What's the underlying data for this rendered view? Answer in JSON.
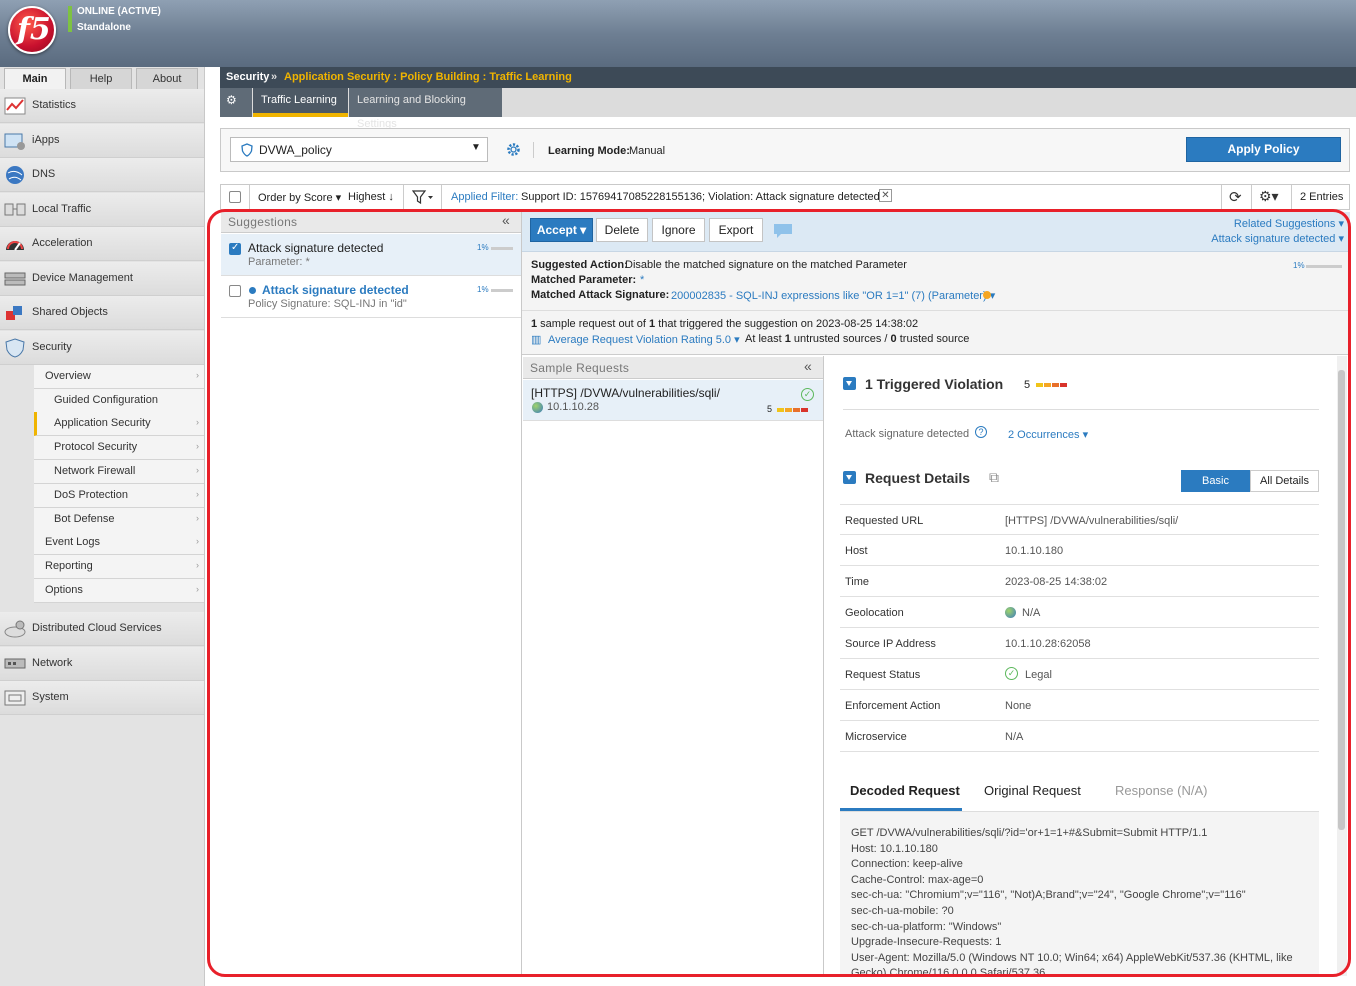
{
  "header": {
    "logo_text": "f5",
    "status_line1": "ONLINE (ACTIVE)",
    "status_line2": "Standalone",
    "status_color": "#7ec242"
  },
  "leftnav": {
    "tabs": [
      "Main",
      "Help",
      "About"
    ],
    "items": [
      {
        "label": "Statistics",
        "icon": "statistics-icon"
      },
      {
        "label": "iApps",
        "icon": "iapps-icon"
      },
      {
        "label": "DNS",
        "icon": "dns-icon"
      },
      {
        "label": "Local Traffic",
        "icon": "local-traffic-icon"
      },
      {
        "label": "Acceleration",
        "icon": "acceleration-icon"
      },
      {
        "label": "Device Management",
        "icon": "device-management-icon"
      },
      {
        "label": "Shared Objects",
        "icon": "shared-objects-icon"
      },
      {
        "label": "Security",
        "icon": "security-icon"
      }
    ],
    "security_sub": [
      "Overview",
      "Guided Configuration",
      "Application Security",
      "Protocol Security",
      "Network Firewall",
      "DoS Protection",
      "Bot Defense",
      "Event Logs",
      "Reporting",
      "Options"
    ],
    "bottom_items": [
      {
        "label": "Distributed Cloud Services",
        "icon": "cloud-icon"
      },
      {
        "label": "Network",
        "icon": "network-icon"
      },
      {
        "label": "System",
        "icon": "system-icon"
      }
    ]
  },
  "breadcrumb": {
    "root": "Security",
    "sep": "»",
    "path": "Application Security : Policy Building : Traffic Learning"
  },
  "subtabs": {
    "gear": "⚙ ▾",
    "tab1": "Traffic Learning",
    "tab2": "Learning and Blocking Settings"
  },
  "policy": {
    "name": "DVWA_policy",
    "learning_mode_label": "Learning Mode:",
    "learning_mode_value": "Manual",
    "apply_label": "Apply Policy"
  },
  "filter": {
    "order": "Order by Score ▾",
    "highest": "Highest ↓",
    "applied_label": "Applied Filter:",
    "applied_value": "Support ID: 15769417085228155136; Violation: Attack signature detected",
    "entries": "2 Entries"
  },
  "suggestions": {
    "title": "Suggestions",
    "collapse": "«",
    "items": [
      {
        "title": "Attack signature detected",
        "sub": "Parameter: *",
        "score": "1%",
        "score_value": 0.01,
        "checked": true
      },
      {
        "title": "Attack signature detected",
        "sub": "Policy Signature: SQL-INJ in \"id\"",
        "score": "1%",
        "score_value": 0.01,
        "checked": false
      }
    ]
  },
  "actions": {
    "accept": "Accept ▾",
    "delete": "Delete",
    "ignore": "Ignore",
    "export": "Export",
    "related": "Related Suggestions ▾",
    "related_sub": "Attack signature detected ▾"
  },
  "suggested": {
    "action_label": "Suggested Action:",
    "action_value": "Disable the matched signature on the matched Parameter",
    "param_label": "Matched Parameter:",
    "param_value": "*",
    "sig_label": "Matched Attack Signature:",
    "sig_value": "200002835 - SQL-INJ expressions like \"OR 1=1\" (7) (Parameter) ▾",
    "score": "1%"
  },
  "sample_info": {
    "line1_a": "1",
    "line1_b": " sample request out of ",
    "line1_c": "1",
    "line1_d": " that triggered the suggestion on 2023-08-25 14:38:02",
    "rating": "Average Request Violation Rating 5.0 ▾",
    "sources_a": "At least ",
    "sources_b": "1",
    "sources_c": " untrusted sources / ",
    "sources_d": "0",
    "sources_e": " trusted source"
  },
  "samples": {
    "title": "Sample Requests",
    "collapse": "«",
    "items": [
      {
        "url": "[HTTPS] /DVWA/vulnerabilities/sqli/",
        "ip": "10.1.10.28",
        "rating": "5"
      }
    ]
  },
  "violation": {
    "title": "1 Triggered Violation",
    "rating": "5",
    "name": "Attack signature detected",
    "occurrences": "2 Occurrences ▾"
  },
  "request_details": {
    "title": "Request Details",
    "basic": "Basic",
    "all": "All Details",
    "rows": [
      {
        "k": "Requested URL",
        "v": "[HTTPS] /DVWA/vulnerabilities/sqli/"
      },
      {
        "k": "Host",
        "v": "10.1.10.180"
      },
      {
        "k": "Time",
        "v": "2023-08-25 14:38:02"
      },
      {
        "k": "Geolocation",
        "v": "N/A"
      },
      {
        "k": "Source IP Address",
        "v": "10.1.10.28:62058"
      },
      {
        "k": "Request Status",
        "v": "Legal"
      },
      {
        "k": "Enforcement Action",
        "v": "None"
      },
      {
        "k": "Microservice",
        "v": "N/A"
      }
    ]
  },
  "request_tabs": {
    "decoded": "Decoded Request",
    "original": "Original Request",
    "response": "Response (N/A)"
  },
  "decoded_lines": [
    "GET /DVWA/vulnerabilities/sqli/?id='or+1=1+#&Submit=Submit HTTP/1.1",
    "Host: 10.1.10.180",
    "Connection: keep-alive",
    "Cache-Control: max-age=0",
    "sec-ch-ua: \"Chromium\";v=\"116\", \"Not)A;Brand\";v=\"24\", \"Google Chrome\";v=\"116\"",
    "sec-ch-ua-mobile: ?0",
    "sec-ch-ua-platform: \"Windows\"",
    "Upgrade-Insecure-Requests: 1",
    "User-Agent: Mozilla/5.0 (Windows NT 10.0; Win64; x64) AppleWebKit/537.36 (KHTML, like",
    "Gecko) Chrome/116.0.0.0 Safari/537.36"
  ],
  "colors": {
    "accent": "#2b7bc0",
    "highlight_frame": "#e8202a",
    "tab_underline": "#f0b400",
    "breadcrumb_path": "#f0b400"
  }
}
